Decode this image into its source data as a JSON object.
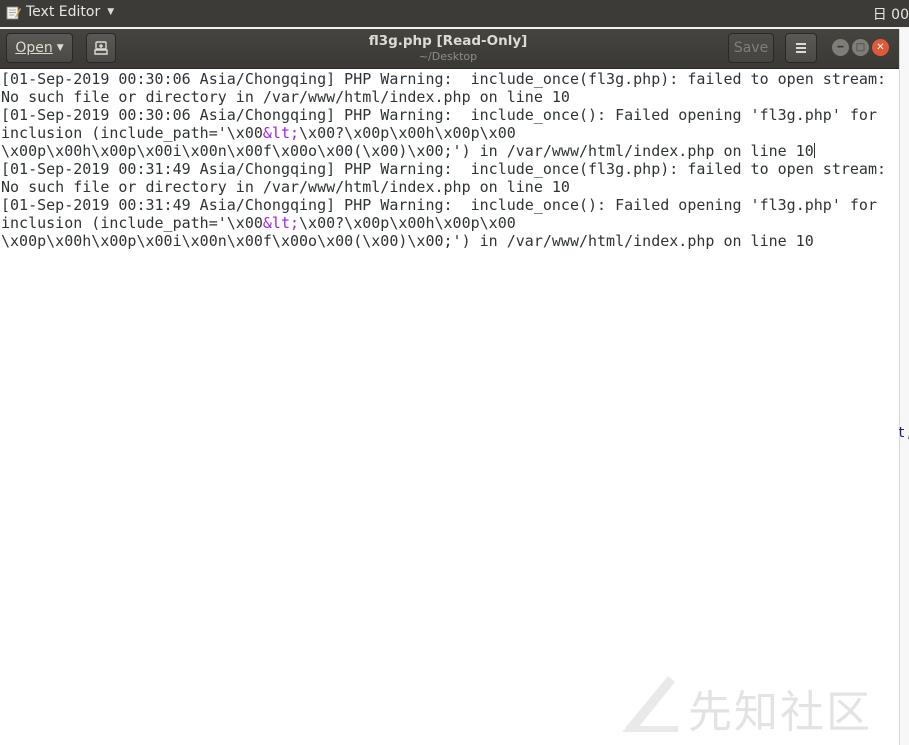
{
  "topbar": {
    "app_name": "Text Editor",
    "clock": "日 00"
  },
  "header": {
    "open_label": "Open",
    "title": "fl3g.php [Read-Only]",
    "subtitle": "~/Desktop",
    "save_label": "Save"
  },
  "editor": {
    "lines": [
      "[01-Sep-2019 00:30:06 Asia/Chongqing] PHP Warning:  include_once(fl3g.php): failed to open stream:",
      "No such file or directory in /var/www/html/index.php on line 10",
      "[01-Sep-2019 00:30:06 Asia/Chongqing] PHP Warning:  include_once(): Failed opening 'fl3g.php' for",
      "inclusion (include_path='\\x00",
      "&lt;",
      "\\x00?\\x00p\\x00h\\x00p\\x00",
      "\\x00p\\x00h\\x00p\\x00i\\x00n\\x00f\\x00o\\x00(\\x00)\\x00;') in /var/www/html/index.php on line 10",
      "[01-Sep-2019 00:31:49 Asia/Chongqing] PHP Warning:  include_once(fl3g.php): failed to open stream:",
      "No such file or directory in /var/www/html/index.php on line 10",
      "[01-Sep-2019 00:31:49 Asia/Chongqing] PHP Warning:  include_once(): Failed opening 'fl3g.php' for",
      "inclusion (include_path='\\x00",
      "&lt;",
      "\\x00?\\x00p\\x00h\\x00p\\x00",
      "\\x00p\\x00h\\x00p\\x00i\\x00n\\x00f\\x00o\\x00(\\x00)\\x00;') in /var/www/html/index.php on line 10"
    ],
    "highlight_color": "#a020f0"
  },
  "right_fragment": "t,",
  "watermark": "先知社区",
  "icons": [
    "text-editor-app-icon",
    "pin-document-icon",
    "hamburger-menu-icon",
    "minimize-icon",
    "maximize-icon",
    "close-icon"
  ]
}
